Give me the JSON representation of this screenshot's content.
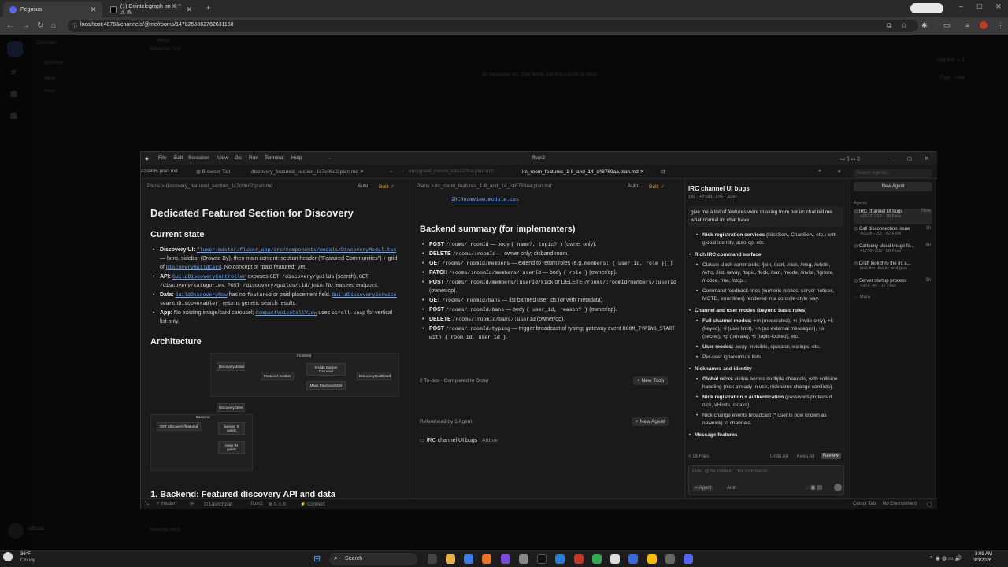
{
  "browser": {
    "tabs": [
      {
        "label": "Pegasus",
        "color": "#5865f2"
      },
      {
        "label": "(1) Cointelegraph on X: \" ⚠ IN",
        "color": "#111"
      }
    ],
    "url": "localhost:48763/channels/@me/rooms/1478256862762631168"
  },
  "bg_app": {
    "channel_header": "#test",
    "subheader": "Sebastian Test",
    "sidebar_title": "Channels",
    "sidebar_items": [
      "#join-#ev",
      "#test",
      "#test"
    ],
    "empty_msg": "No messages yet. Type below and press Enter to send.",
    "online": "ONLINE — 1",
    "member": "Flyyf · 2d4b",
    "user": "official",
    "input_ph": "Message #test"
  },
  "editor": {
    "title": "fluxr2",
    "menu": [
      "File",
      "Edit",
      "Selection",
      "View",
      "Go",
      "Run",
      "Terminal",
      "Help"
    ],
    "tabs": [
      "a2d406.plan.md",
      "Browser Tab",
      "discovery_featured_section_1c7c06d2.plan.md",
      "encrypted_rooms_c9a237ca.plan.md",
      "irc_room_features_1-8_and_14_c48769aa.plan.md"
    ],
    "left": {
      "crumb": "Plans  >  discovery_featured_section_1c7c06d2.plan.md",
      "mode": "Auto",
      "built": "Built ✓",
      "title": "Dedicated Featured Section for Discovery",
      "h_state": "Current state",
      "s1_b": "Discovery UI:",
      "s1_link": "fluxer-master/fluxer_app/src/components/modals/DiscoveryModal.tsx",
      "s1_rest": "— hero, sidebar (Browse By), then main content: section header (\"Featured Communities\") + grid of",
      "s1_link2": "DiscoveryGuildCard",
      "s1_end": ". No concept of \"paid featured\" yet.",
      "s2_b": "API:",
      "s2_link": "GuildDiscoveryController",
      "s2_mid": "exposes",
      "s2_code1": "GET /discovery/guilds",
      "s2_t1": "(search),",
      "s2_code2": "GET /discovery/categories",
      "s2_code3": "POST /discovery/guilds/:id/join",
      "s2_end": ". No featured endpoint.",
      "s3_b": "Data:",
      "s3_link": "GuildDiscoveryRow",
      "s3_mid": "has no",
      "s3_code": "featured",
      "s3_end": "or paid-placement field.",
      "s3_link2": "GuildDiscoveryService",
      "s3_code2": "searchDiscoverable()",
      "s3_end2": "returns generic search results.",
      "s4_b": "App:",
      "s4_t": "No existing image/card carousel;",
      "s4_link": "CompactVoiceCallView",
      "s4_t2": "uses",
      "s4_code": "scroll-snap",
      "s4_end": "for vertical list only.",
      "h_arch": "Architecture",
      "diagram": {
        "frontend": "Frontend",
        "modal": "DiscoveryModal",
        "featured": "Featured Section",
        "banner": "5-slide Banner Carousel",
        "grid": "Mass Paid/card Grid",
        "card": "DiscoveryGuildCard",
        "store": "DiscoveryStore",
        "backend": "Backend",
        "get": "GET /discovery/featured",
        "banners": "banner: 5 guilds",
        "rest": "ream: N guilds"
      },
      "h_backend": "1. Backend: Featured discovery API and data"
    },
    "mid": {
      "crumb": "Plans  >  irc_room_features_1-8_and_14_c48769aa.plan.md",
      "mode": "Auto",
      "built": "Built ✓",
      "top_link": "IRCRoomView.module.css",
      "h": "Backend summary (for implementers)",
      "rows": [
        [
          "POST",
          "/rooms/:roomId",
          " — body ",
          "{ name?, topic? }",
          " (owner only)."
        ],
        [
          "DELETE",
          "/rooms/:roomId",
          " — owner only; disband room.",
          "",
          ""
        ],
        [
          "GET",
          "/rooms/:roomId/members",
          " — extend to return roles (e.g. ",
          "members: { user_id, role }[]",
          ")."
        ],
        [
          "PATCH",
          "/rooms/:roomId/members/:userId",
          " — body ",
          "{ role }",
          " (owner/op)."
        ],
        [
          "POST",
          "/rooms/:roomId/members/:userId/kick",
          " or DELETE ",
          "/rooms/:roomId/members/:userId",
          " (owner/op)."
        ],
        [
          "GET",
          "/rooms/:roomId/bans",
          " — list banned user ids (or with metadata).",
          "",
          ""
        ],
        [
          "POST",
          "/rooms/:roomId/bans",
          " — body ",
          "{ user_id, reason? }",
          " (owner/op)."
        ],
        [
          "DELETE",
          "/rooms/:roomId/bans/:userId",
          " (owner/op).",
          "",
          ""
        ],
        [
          "POST",
          "/rooms/:roomId/typing",
          " — trigger broadcast of typing; gateway event ",
          "ROOM_TYPING_START with { room_id, user_id }",
          "."
        ]
      ],
      "todos": "0 To-dos · Completed In Order",
      "new_todo": "+ New Todo",
      "referenced": "Referenced by 1 Agent",
      "new_agent": "+ New Agent",
      "ref_item": "IRC channel UI bugs",
      "ref_role": "· Author"
    },
    "chat": {
      "title": "IRC channel UI bugs",
      "meta": "1m · +2343 -335 · Auto",
      "prompt": "give me a list of features were missing from our irc chat tell me what normal irc chat have",
      "items": [
        {
          "t": "sub",
          "b": "Nick registration services",
          "r": "(NickServ, ChanServ, etc.) with global identity, auto-op, etc."
        },
        {
          "t": "head",
          "b": "Rich IRC command surface",
          "r": ""
        },
        {
          "t": "sub",
          "b": "",
          "r": "Classic slash commands: /join, /part, /nick, /msg, /whois, /who, /list, /away, /topic, /kick, /ban, /mode, /invite, /ignore, /notice, /me, /ctcp..."
        },
        {
          "t": "sub",
          "b": "",
          "r": "Command feedback lines (numeric replies, server notices, MOTD, error lines) rendered in a console-style way."
        },
        {
          "t": "head",
          "b": "Channel and user modes (beyond basic roles)",
          "r": ""
        },
        {
          "t": "sub",
          "b": "Full channel modes:",
          "r": "+m (moderated), +i (invite-only), +k (keyed), +l (user limit), +n (no external messages), +s (secret), +p (private), +t (topic-locked), etc."
        },
        {
          "t": "sub",
          "b": "User modes:",
          "r": "away, invisible, operator, wallops, etc."
        },
        {
          "t": "sub",
          "b": "",
          "r": "Per-user ignore/mute lists."
        },
        {
          "t": "head",
          "b": "Nicknames and identity",
          "r": ""
        },
        {
          "t": "sub",
          "b": "Global nicks",
          "r": "visible across multiple channels, with collision handling (nick already in use, nickname change conflicts)."
        },
        {
          "t": "sub",
          "b": "Nick registration + authentication",
          "r": "(password-protected nick, vHosts, cloaks)."
        },
        {
          "t": "sub",
          "b": "",
          "r": "Nick change events broadcast (* user is now known as newnick) to channels."
        },
        {
          "t": "head",
          "b": "Message features",
          "r": ""
        }
      ],
      "files": "> 18 Files",
      "undo": "Undo All",
      "keep": "Keep All",
      "review": "Review",
      "input_ph": "Plan, @ for context, / for commands",
      "agent_sel": "Agent",
      "auto_sel": "Auto"
    },
    "agents": {
      "search_ph": "Search Agents...",
      "new_agent": "New Agent",
      "section": "Agents",
      "items": [
        {
          "name": "IRC channel UI bugs",
          "time": "Now",
          "meta": "+2532 -312 · 18 Files"
        },
        {
          "name": "Call disconnection issue",
          "time": "1h",
          "meta": "+6108 -152 · 62 Files"
        },
        {
          "name": "Cartoony cloud image fo...",
          "time": "6h",
          "meta": "+1730 -305 · 28 Files"
        },
        {
          "name": "Draft look thru the irc a...",
          "time": "",
          "meta": "look thru the irc and give ..."
        },
        {
          "name": "Server startup process",
          "time": "9h",
          "meta": "+376 -44 · 17 Files"
        }
      ],
      "more": "More"
    },
    "status": {
      "branch": "master*",
      "errors": "⊗ 0 ⚠ 0",
      "launchpad": "Launchpad",
      "project": "fluxr2",
      "connect": "Connect",
      "cursor_tab": "Cursor Tab",
      "env": "No Environment"
    }
  },
  "taskbar": {
    "weather_temp": "36°F",
    "weather_desc": "Cloudy",
    "search": "Search",
    "time": "3:09 AM",
    "date": "3/3/2026"
  },
  "colors": {
    "accent": "#e0a030",
    "link": "#6ea8ff",
    "add": "#4caf50",
    "del": "#e05050"
  }
}
